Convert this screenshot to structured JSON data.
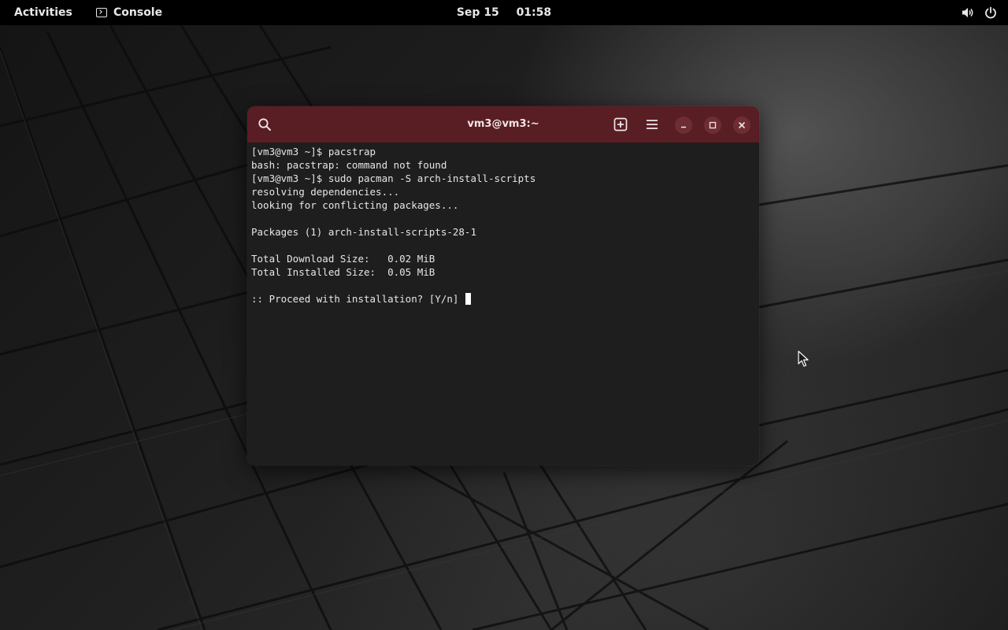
{
  "topbar": {
    "activities_label": "Activities",
    "app_name": "Console",
    "date": "Sep 15",
    "time": "01:58",
    "system_icons": [
      "volume-icon",
      "power-icon"
    ]
  },
  "window": {
    "title": "vm3@vm3:~",
    "header_color": "#591d24",
    "header_buttons": [
      "search-icon",
      "new-tab-icon",
      "menu-icon",
      "minimize-icon",
      "maximize-icon",
      "close-icon"
    ]
  },
  "terminal": {
    "background": "#1e1e1e",
    "lines": [
      "[vm3@vm3 ~]$ pacstrap",
      "bash: pacstrap: command not found",
      "[vm3@vm3 ~]$ sudo pacman -S arch-install-scripts",
      "resolving dependencies...",
      "looking for conflicting packages...",
      "",
      "Packages (1) arch-install-scripts-28-1",
      "",
      "Total Download Size:   0.02 MiB",
      "Total Installed Size:  0.05 MiB",
      "",
      ":: Proceed with installation? [Y/n] "
    ]
  }
}
